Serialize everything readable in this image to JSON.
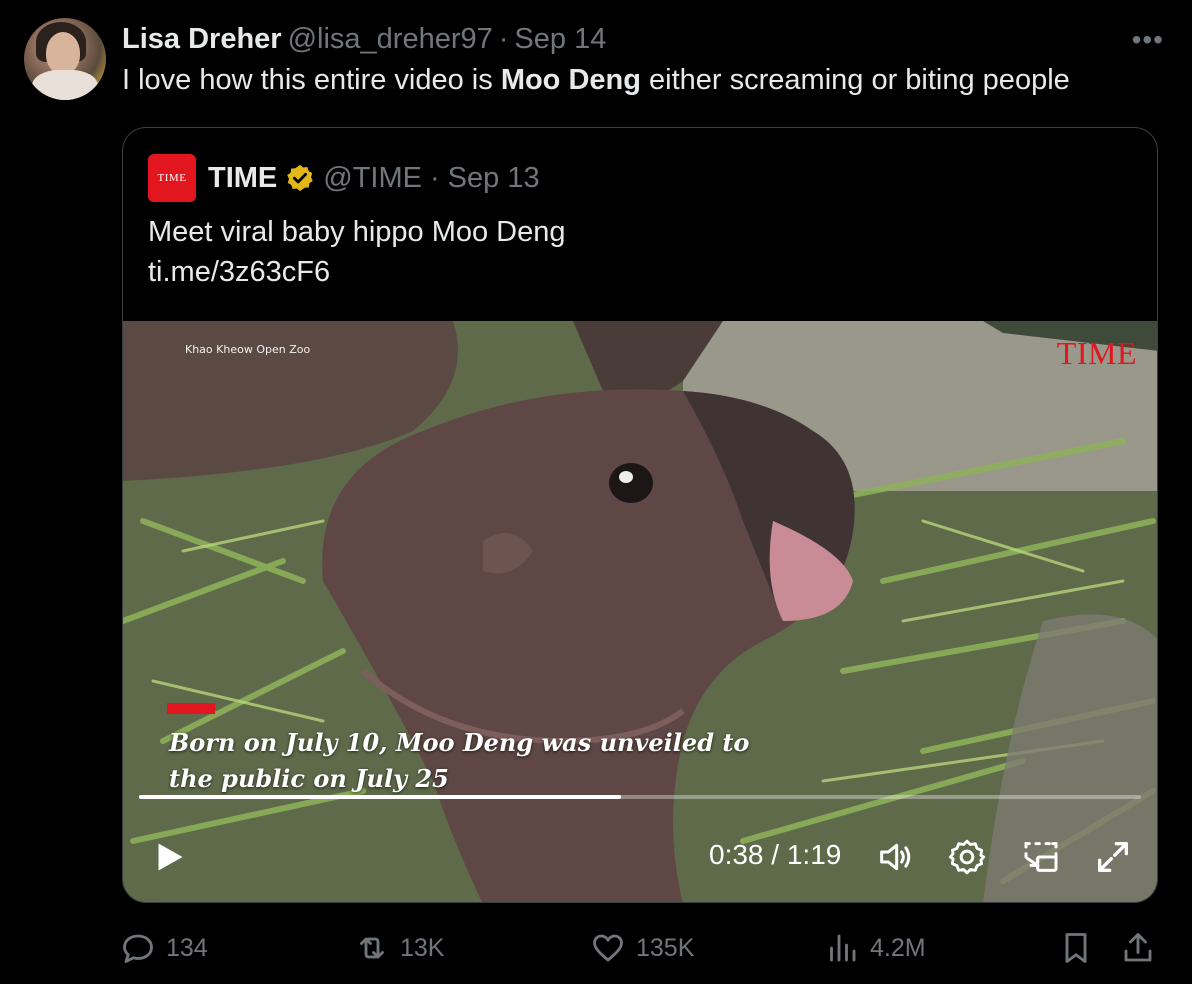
{
  "author": {
    "name": "Lisa Dreher",
    "handle": "@lisa_dreher97",
    "separator": "·",
    "date": "Sep 14"
  },
  "tweet": {
    "text_before": "I love how this entire video is ",
    "text_bold": "Moo Deng",
    "text_after": " either screaming or biting people"
  },
  "more_label": "•••",
  "quoted": {
    "logo_text": "TIME",
    "name": "TIME",
    "handle": "@TIME",
    "separator": "·",
    "date": "Sep 13",
    "text": "Meet viral baby hippo Moo Deng",
    "link": "ti.me/3z63cF6",
    "verified_color": "#e2b719"
  },
  "video": {
    "source_label": "Khao Kheow Open Zoo",
    "watermark": "TIME",
    "caption_line1": "Born on July 10, Moo Deng was unveiled to",
    "caption_line2": "the public on July 25",
    "current_time": "0:38",
    "time_separator": " / ",
    "duration": "1:19",
    "progress_fraction": 0.481,
    "controls": [
      "play-icon",
      "volume-icon",
      "settings-icon",
      "pip-icon",
      "fullscreen-icon"
    ]
  },
  "actions": {
    "replies": "134",
    "retweets": "13K",
    "likes": "135K",
    "views": "4.2M"
  },
  "colors": {
    "background": "#000000",
    "text": "#e7e9ea",
    "muted": "#71767b",
    "time_red": "#e1161e"
  }
}
